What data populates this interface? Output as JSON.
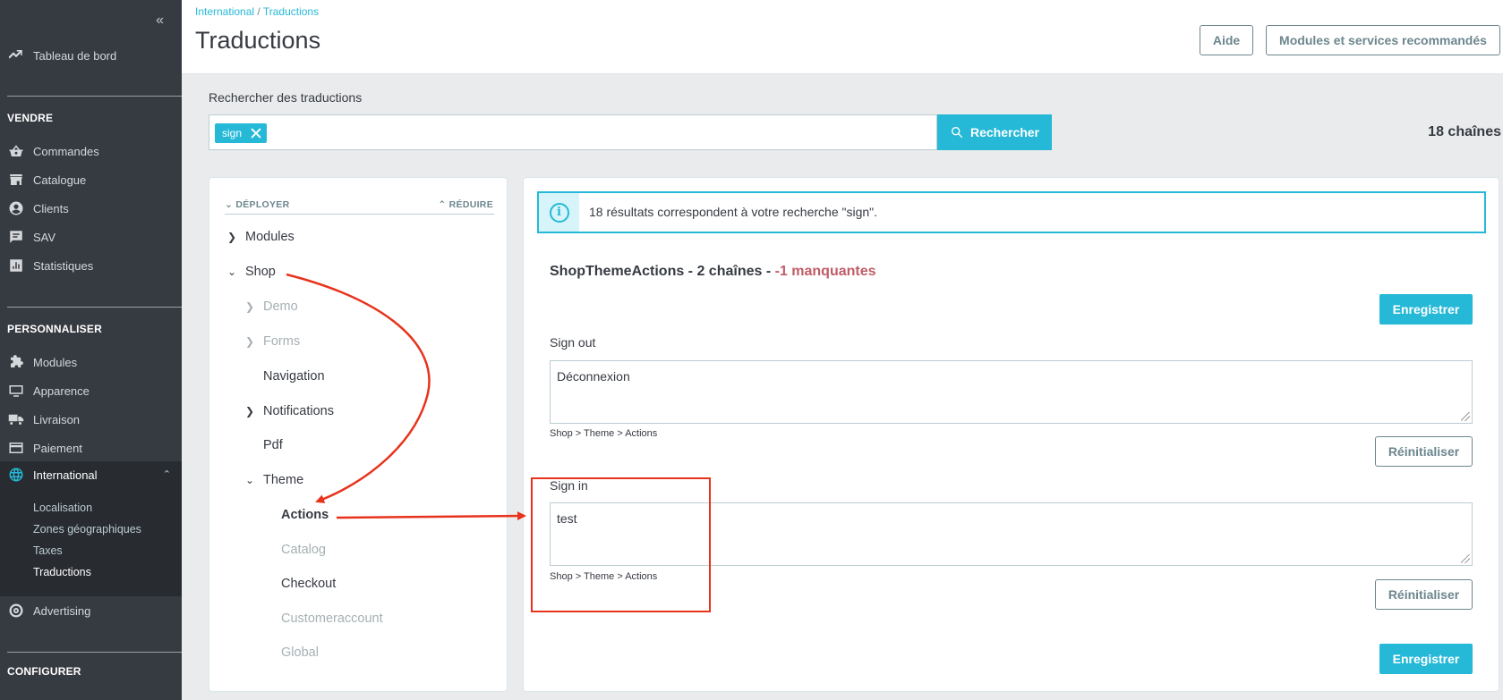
{
  "sidebar": {
    "dashboard": "Tableau de bord",
    "section_sell": "VENDRE",
    "sell_items": [
      "Commandes",
      "Catalogue",
      "Clients",
      "SAV",
      "Statistiques"
    ],
    "section_customize": "PERSONNALISER",
    "customize_items": [
      "Modules",
      "Apparence",
      "Livraison",
      "Paiement",
      "International"
    ],
    "international_sub": [
      "Localisation",
      "Zones géographiques",
      "Taxes",
      "Traductions"
    ],
    "advertising": "Advertising",
    "section_configure": "CONFIGURER"
  },
  "header": {
    "breadcrumb_parent": "International",
    "breadcrumb_sep": " / ",
    "breadcrumb_current": "Traductions",
    "title": "Traductions",
    "help_label": "Aide",
    "modules_label": "Modules et services recommandés"
  },
  "search": {
    "label": "Rechercher des traductions",
    "tag": "sign",
    "button": "Rechercher",
    "count": "18 chaînes"
  },
  "tree": {
    "expand": "DÉPLOYER",
    "reduce": "RÉDUIRE",
    "nodes": [
      "Modules",
      "Shop",
      "Demo",
      "Forms",
      "Navigation",
      "Notifications",
      "Pdf",
      "Theme",
      "Actions",
      "Catalog",
      "Checkout",
      "Customeraccount",
      "Global"
    ]
  },
  "content": {
    "alert": "18 résultats correspondent à votre recherche \"sign\".",
    "domain_title": "ShopThemeActions - 2 chaînes - ",
    "domain_missing": "-1 manquantes",
    "save_label": "Enregistrer",
    "reset_label": "Réinitialiser",
    "translations": [
      {
        "label": "Sign out",
        "value": "Déconnexion",
        "path": "Shop > Theme > Actions"
      },
      {
        "label": "Sign in",
        "value": "test",
        "path": "Shop > Theme > Actions"
      }
    ]
  },
  "colors": {
    "accent": "#25b9d7",
    "sidebar": "#363a41",
    "annotation": "#e8331c",
    "missing": "#c05c67"
  }
}
